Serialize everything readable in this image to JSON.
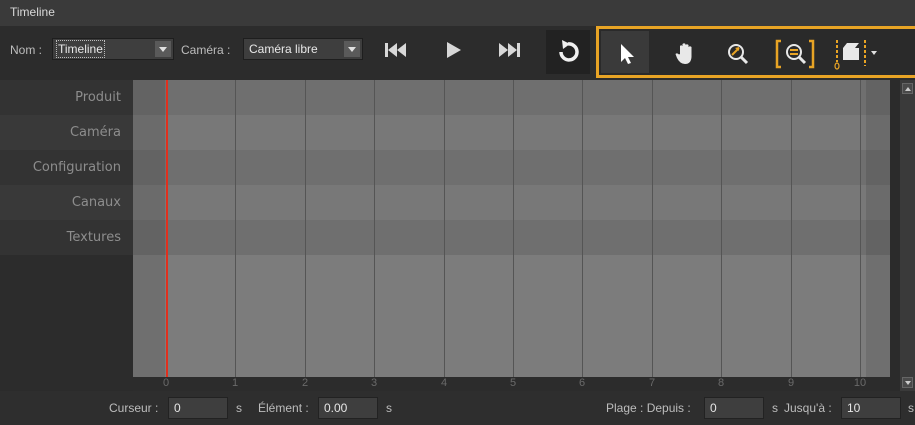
{
  "window": {
    "title": "Timeline"
  },
  "toolbar": {
    "name_label": "Nom :",
    "name_value": "Timeline",
    "camera_label": "Caméra :",
    "camera_value": "Caméra libre"
  },
  "tools": {
    "highlight_color": "#e8a425",
    "items": [
      {
        "icon": "select-arrow-icon",
        "selected": true
      },
      {
        "icon": "pan-hand-icon",
        "selected": false
      },
      {
        "icon": "zoom-icon",
        "selected": false
      },
      {
        "icon": "zoom-fit-icon",
        "selected": false
      },
      {
        "icon": "keyframe-camera-icon",
        "selected": false
      }
    ]
  },
  "tracks": [
    "Produit",
    "Caméra",
    "Configuration",
    "Canaux",
    "Textures"
  ],
  "ruler": {
    "ticks": [
      "0",
      "1",
      "2",
      "3",
      "4",
      "5",
      "6",
      "7",
      "8",
      "9",
      "10"
    ]
  },
  "cursor": {
    "position": 0,
    "color": "#e0301e"
  },
  "status": {
    "cursor_label": "Curseur :",
    "cursor_value": "0",
    "cursor_unit": "s",
    "element_label": "Élément :",
    "element_value": "0.00",
    "element_unit": "s",
    "range_from_label": "Plage : Depuis :",
    "range_from_value": "0",
    "range_from_unit": "s",
    "range_to_label": "Jusqu'à :",
    "range_to_value": "10",
    "range_to_unit": "s"
  }
}
